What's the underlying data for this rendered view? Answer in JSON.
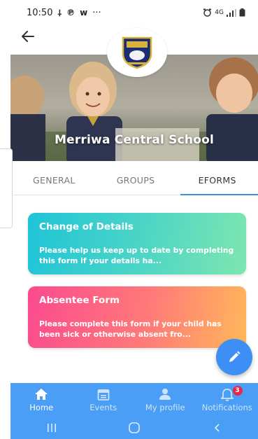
{
  "status_bar": {
    "time": "10:50",
    "notif_glyphs": [
      "⸸",
      "℗",
      "w",
      "···"
    ],
    "network": "4G"
  },
  "school": {
    "name": "Merriwa Central School"
  },
  "tabs": [
    {
      "label": "GENERAL",
      "active": false
    },
    {
      "label": "GROUPS",
      "active": false
    },
    {
      "label": "EFORMS",
      "active": true
    }
  ],
  "forms": [
    {
      "title": "Change of Details",
      "description": "Please help us keep up to date by completing this form if your details ha..."
    },
    {
      "title": "Absentee Form",
      "description": "Please complete this form if your child has been sick or otherwise absent fro..."
    }
  ],
  "bottom_nav": [
    {
      "label": "Home",
      "icon": "home-icon",
      "active": true
    },
    {
      "label": "Events",
      "icon": "calendar-icon",
      "active": false
    },
    {
      "label": "My profile",
      "icon": "person-icon",
      "active": false
    },
    {
      "label": "Notifications",
      "icon": "bell-icon",
      "active": false,
      "badge": "3"
    }
  ],
  "colors": {
    "accent": "#3d8ef5",
    "nav_bg": "#4a9ef5",
    "badge": "#e8264a"
  }
}
